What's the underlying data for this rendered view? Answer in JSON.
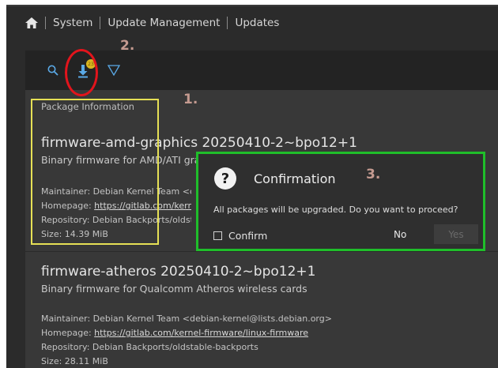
{
  "breadcrumb": {
    "items": [
      "System",
      "Update Management",
      "Updates"
    ]
  },
  "toolbar": {
    "update_badge_count": "23"
  },
  "annotations": {
    "label1": "1.",
    "label2": "2.",
    "label3": "3."
  },
  "packages": [
    {
      "section_label": "Package Information",
      "title": "firmware-amd-graphics 20250410-2~bpo12+1",
      "description": "Binary firmware for AMD/ATI graphics chips",
      "maintainer_label": "Maintainer:",
      "maintainer": "Debian Kernel Team <debian-kernel@lists.debian.org>",
      "homepage_label": "Homepage:",
      "homepage": "https://gitlab.com/kernel-firmware/linux-firmware",
      "repository_label": "Repository:",
      "repository": "Debian Backports/oldstable-backports",
      "size_label": "Size:",
      "size": "14.39 MiB"
    },
    {
      "title": "firmware-atheros 20250410-2~bpo12+1",
      "description": "Binary firmware for Qualcomm Atheros wireless cards",
      "maintainer_label": "Maintainer:",
      "maintainer": "Debian Kernel Team <debian-kernel@lists.debian.org>",
      "homepage_label": "Homepage:",
      "homepage": "https://gitlab.com/kernel-firmware/linux-firmware",
      "repository_label": "Repository:",
      "repository": "Debian Backports/oldstable-backports",
      "size_label": "Size:",
      "size": "28.11 MiB"
    }
  ],
  "dialog": {
    "title": "Confirmation",
    "icon": "question-icon",
    "message": "All packages will be upgraded. Do you want to proceed?",
    "confirm_label": "Confirm",
    "no_label": "No",
    "yes_label": "Yes"
  },
  "colors": {
    "annotation_yellow": "#e6e055",
    "annotation_red": "#e2141c",
    "annotation_green": "#1fbe2a",
    "badge_yellow": "#d9b51f",
    "download_blue": "#5aa9e6"
  }
}
